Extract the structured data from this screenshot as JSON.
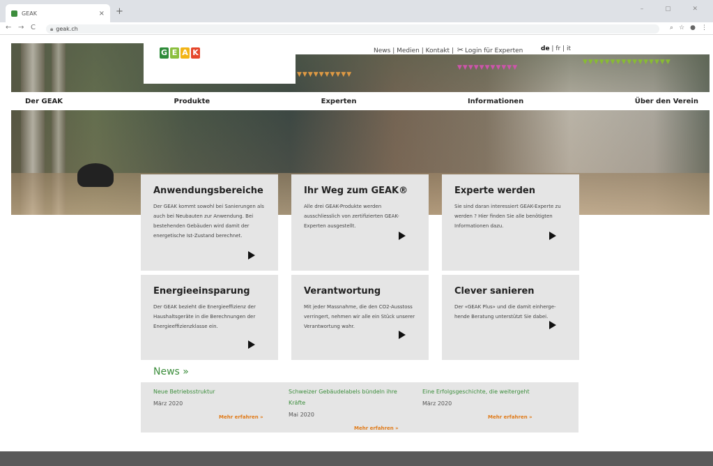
{
  "browser": {
    "tab_title": "GEAK",
    "tab_close": "×",
    "new_tab": "+",
    "window_controls": "– ▢ ✕",
    "url": "geak.ch",
    "back": "←",
    "forward": "→",
    "reload": "C"
  },
  "header": {
    "logo_letters": [
      "G",
      "E",
      "A",
      "K"
    ],
    "logo_colors": [
      "#2e8b3a",
      "#8cbf3f",
      "#f2b416",
      "#e5452a"
    ],
    "top_links": [
      "News",
      "Medien",
      "Kontakt"
    ],
    "login_label": "Login für Experten",
    "languages": [
      "de",
      "fr",
      "it"
    ],
    "active_language": "de"
  },
  "main_nav": [
    "Der GEAK",
    "Produkte",
    "Experten",
    "Informationen",
    "Über den Verein"
  ],
  "cards": [
    {
      "title": "Anwendungsbereiche",
      "text": "Der GEAK kommt sowohl bei Sanierungen als auch bei Neubauten zur Anwendung. Bei bestehenden Gebäuden wird damit der energetische Ist-Zustand berechnet."
    },
    {
      "title": "Ihr Weg zum GEAK®",
      "text": "Alle drei GEAK-Produkte werden ausschliesslich von zertifizierten GEAK-Experten ausgestellt."
    },
    {
      "title": "Experte werden",
      "text": "Sie sind daran interessiert GEAK-Experte zu werden ? Hier finden Sie alle benötigten Informationen dazu."
    },
    {
      "title": "Energieeinsparung",
      "text": "Der GEAK bezieht die Energieeffizienz der Haushaltsgeräte in die Berechnungen der Energieeffizienzklasse ein."
    },
    {
      "title": "Verantwortung",
      "text": "Mit jeder Massnahme, die den CO2-Ausstoss verringert, nehmen wir alle ein Stück unserer Verantwortung wahr."
    },
    {
      "title": "Clever sanieren",
      "text": "Der «GEAK Plus» und die damit einherge-hende Beratung unterstützt Sie dabei."
    }
  ],
  "news": {
    "title": "News »",
    "items": [
      {
        "title": "Neue Betriebsstruktur",
        "date": "März 2020",
        "more": "Mehr erfahren »"
      },
      {
        "title": "Schweizer Gebäudelabels bündeln ihre Kräfte",
        "date": "Mai 2020",
        "more": "Mehr erfahren »"
      },
      {
        "title": "Eine Erfolgsgeschichte, die weitergeht",
        "date": "März 2020",
        "more": "Mehr erfahren »"
      }
    ]
  }
}
